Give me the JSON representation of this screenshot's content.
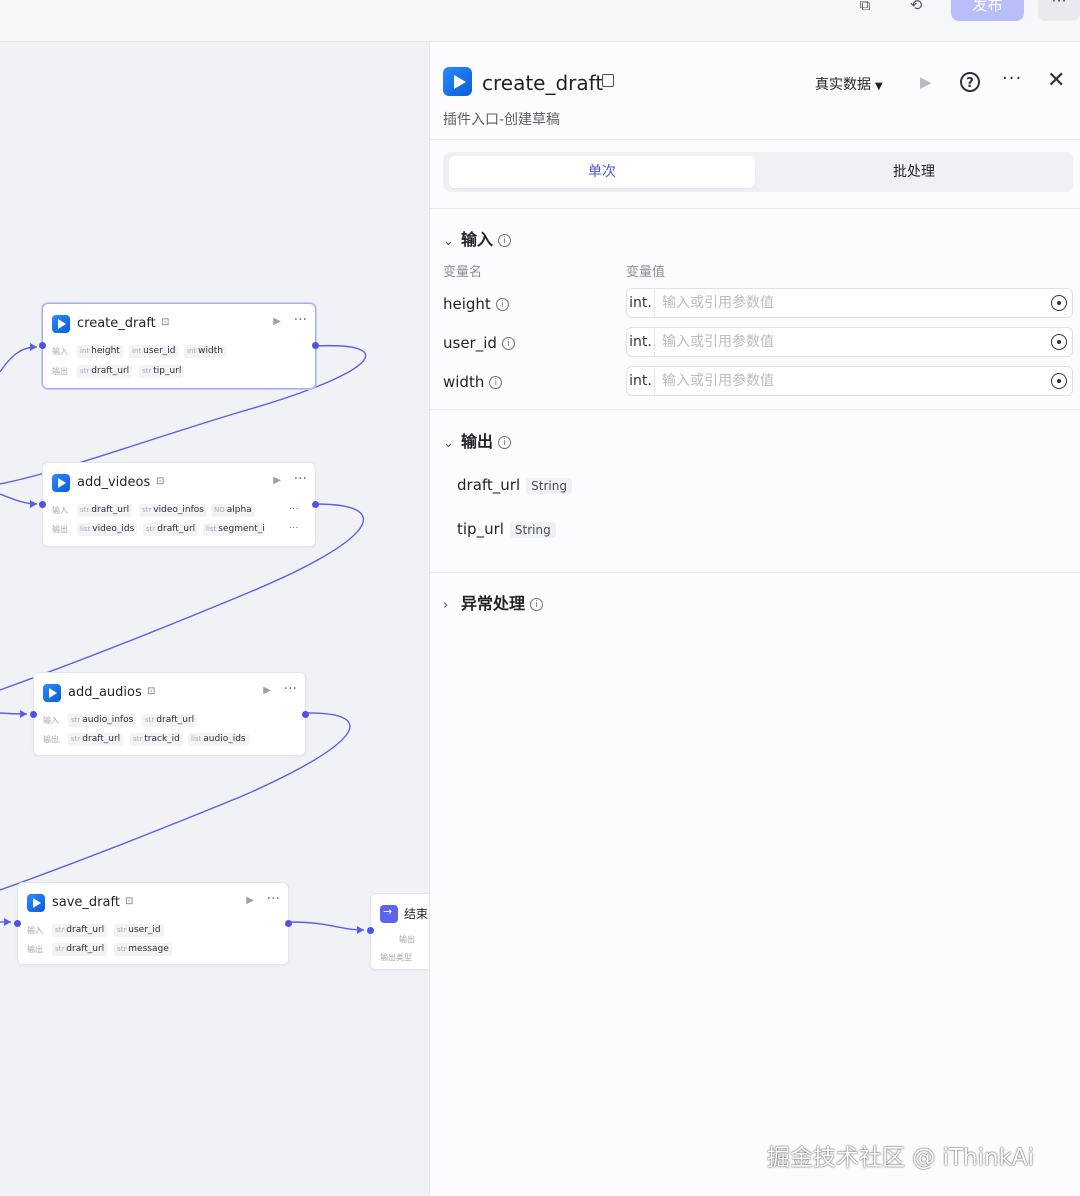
{
  "topbar": {
    "publish_label": "发布",
    "more_label": "···"
  },
  "canvas": {
    "nodes": [
      {
        "title": "create_draft",
        "input_label": "输入",
        "output_label": "输出",
        "inputs": [
          {
            "type": "int",
            "name": "height"
          },
          {
            "type": "int",
            "name": "user_id"
          },
          {
            "type": "int",
            "name": "width"
          }
        ],
        "outputs": [
          {
            "type": "str",
            "name": "draft_url"
          },
          {
            "type": "str",
            "name": "tip_url"
          }
        ]
      },
      {
        "title": "add_videos",
        "input_label": "输入",
        "output_label": "输出",
        "inputs": [
          {
            "type": "str",
            "name": "draft_url"
          },
          {
            "type": "str",
            "name": "video_infos"
          },
          {
            "type": "NO",
            "name": "alpha"
          }
        ],
        "outputs": [
          {
            "type": "list",
            "name": "video_ids"
          },
          {
            "type": "str",
            "name": "draft_url"
          },
          {
            "type": "list",
            "name": "segment_i"
          }
        ]
      },
      {
        "title": "add_audios",
        "input_label": "输入",
        "output_label": "输出",
        "inputs": [
          {
            "type": "str",
            "name": "audio_infos"
          },
          {
            "type": "str",
            "name": "draft_url"
          }
        ],
        "outputs": [
          {
            "type": "str",
            "name": "draft_url"
          },
          {
            "type": "str",
            "name": "track_id"
          },
          {
            "type": "list",
            "name": "audio_ids"
          }
        ]
      },
      {
        "title": "save_draft",
        "input_label": "输入",
        "output_label": "输出",
        "inputs": [
          {
            "type": "str",
            "name": "draft_url"
          },
          {
            "type": "str",
            "name": "user_id"
          }
        ],
        "outputs": [
          {
            "type": "str",
            "name": "draft_url"
          },
          {
            "type": "str",
            "name": "message"
          }
        ]
      }
    ],
    "end_node": {
      "title": "结束",
      "output_label": "输出",
      "output_type_label": "输出类型"
    }
  },
  "panel": {
    "title": "create_draft",
    "description": "插件入口-创建草稿",
    "mode_selector": "真实数据",
    "more_label": "···",
    "close_label": "✕",
    "help_label": "?",
    "tabs": [
      {
        "label": "单次",
        "active": true
      },
      {
        "label": "批处理",
        "active": false
      }
    ],
    "input_section": {
      "title": "输入",
      "col_name": "变量名",
      "col_value": "变量值",
      "variables": [
        {
          "name": "height",
          "type": "int.",
          "placeholder": "输入或引用参数值"
        },
        {
          "name": "user_id",
          "type": "int.",
          "placeholder": "输入或引用参数值"
        },
        {
          "name": "width",
          "type": "int.",
          "placeholder": "输入或引用参数值"
        }
      ]
    },
    "output_section": {
      "title": "输出",
      "fields": [
        {
          "name": "draft_url",
          "type": "String"
        },
        {
          "name": "tip_url",
          "type": "String"
        }
      ]
    },
    "exception_section": {
      "title": "异常处理"
    }
  },
  "watermark": "掘金技术社区 @ iThinkAi",
  "colors": {
    "accent": "#4d53e8",
    "publish_button": "#b9bdf8",
    "wire": "#5a5fe6"
  }
}
